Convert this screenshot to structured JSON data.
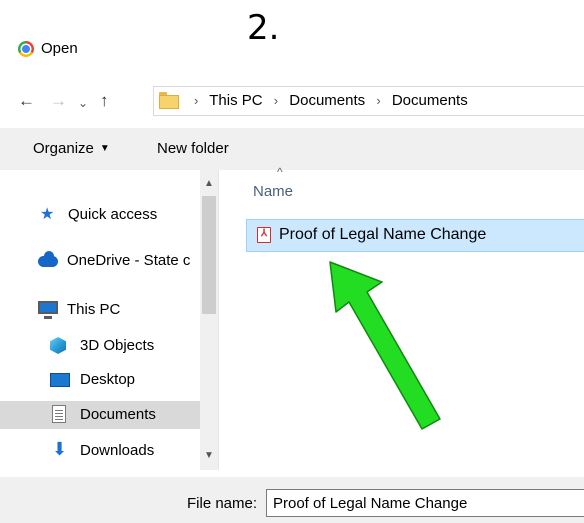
{
  "step_label": "2.",
  "window": {
    "title": "Open",
    "icon": "chrome-icon"
  },
  "nav": {
    "back": "←",
    "forward": "→",
    "recent": "⌄",
    "up": "↑",
    "breadcrumbs": [
      "This PC",
      "Documents",
      "Documents"
    ],
    "separator": "›"
  },
  "toolbar": {
    "organize_label": "Organize",
    "organize_caret": "▼",
    "new_folder_label": "New folder"
  },
  "sidebar": {
    "items": [
      {
        "label": "Quick access",
        "icon": "star-icon"
      },
      {
        "label": "OneDrive - State c",
        "icon": "cloud-icon"
      },
      {
        "label": "This PC",
        "icon": "computer-icon"
      },
      {
        "label": "3D Objects",
        "icon": "cube-icon"
      },
      {
        "label": "Desktop",
        "icon": "desktop-icon"
      },
      {
        "label": "Documents",
        "icon": "documents-icon",
        "selected": true
      },
      {
        "label": "Downloads",
        "icon": "download-icon"
      }
    ],
    "star_glyph": "★",
    "download_glyph": "⬇",
    "scroll_up": "▲",
    "scroll_down": "▼"
  },
  "content": {
    "column_header": "Name",
    "sort_caret": "^",
    "files": [
      {
        "name": "Proof of Legal Name Change",
        "icon": "pdf-icon",
        "icon_glyph": "⅄",
        "selected": true
      }
    ]
  },
  "footer": {
    "file_name_label": "File name:",
    "file_name_value": "Proof of Legal Name Change"
  },
  "colors": {
    "selection_bg": "#cce8ff",
    "selection_border": "#99d1ff",
    "annotation_arrow": "#22dd22",
    "toolbar_bg": "#f0f0f0"
  }
}
